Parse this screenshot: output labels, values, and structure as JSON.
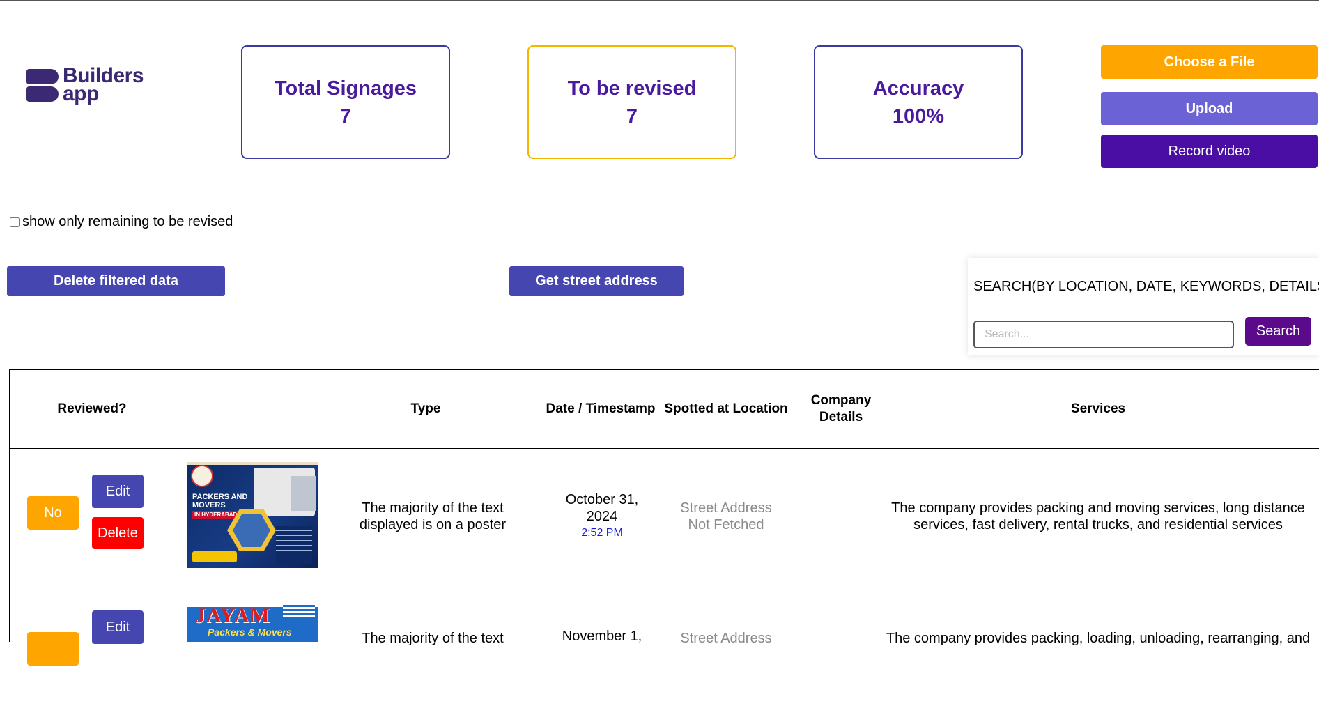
{
  "app": {
    "logo_line1": "Builders",
    "logo_line2": "app"
  },
  "stats": [
    {
      "label": "Total Signages",
      "value": "7"
    },
    {
      "label": "To be revised",
      "value": "7"
    },
    {
      "label": "Accuracy",
      "value": "100%"
    }
  ],
  "actions": {
    "choose_file": "Choose a File",
    "upload": "Upload",
    "record_video": "Record video"
  },
  "filter": {
    "checkbox_label": "show only remaining to be revised",
    "checked": false
  },
  "toolbar": {
    "delete_filtered": "Delete filtered data",
    "get_street_address": "Get street address"
  },
  "search": {
    "title": "SEARCH(BY LOCATION, DATE, KEYWORDS, DETAILS...)",
    "placeholder": "Search...",
    "button": "Search"
  },
  "table": {
    "headers": [
      "Reviewed?",
      "Type",
      "Date / Timestamp",
      "Spotted at Location",
      "Company Details",
      "Services"
    ],
    "header_company_line1": "Company",
    "header_company_line2": "Details",
    "rows": [
      {
        "reviewed": "No",
        "edit": "Edit",
        "delete": "Delete",
        "image_title": "PACKERS AND MOVERS",
        "image_sub": "IN HYDERABAD",
        "type": "The majority of the text displayed is on a poster",
        "date": "October 31, 2024",
        "time": "2:52 PM",
        "location": "Street Address Not Fetched",
        "company": "",
        "services": "The company provides packing and moving services, long distance services, fast delivery, rental trucks, and residential services"
      },
      {
        "reviewed": "",
        "edit": "Edit",
        "delete": "",
        "image_title": "JAYAM",
        "image_sub": "Packers & Movers",
        "type": "The majority of the text",
        "date": "November 1,",
        "location": "Street Address",
        "company": "",
        "services": "The company provides packing, loading, unloading, rearranging, and"
      }
    ]
  },
  "colors": {
    "orange": "#ffa500",
    "indigo": "#4646b0",
    "purple": "#4a1a9e",
    "red": "#ff0000"
  }
}
